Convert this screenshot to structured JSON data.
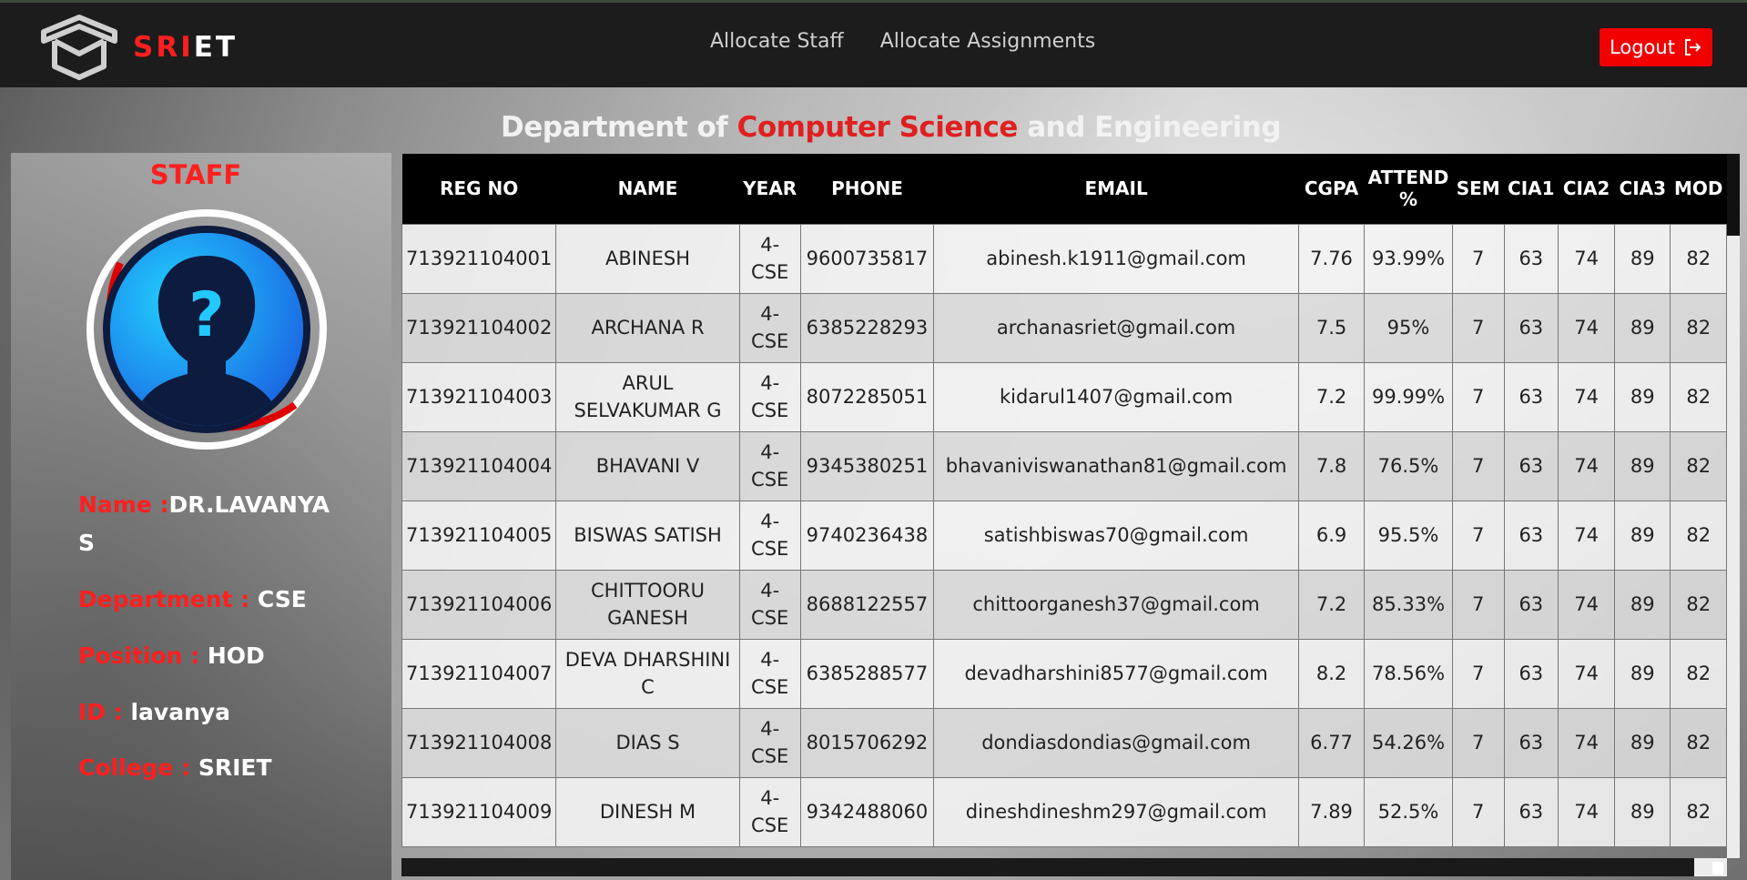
{
  "brand": {
    "part1": "SRI",
    "part2": "ET"
  },
  "nav": [
    {
      "label": "Allocate Staff"
    },
    {
      "label": "Allocate Assignments"
    }
  ],
  "logout_label": "Logout",
  "heading": {
    "prefix": "Department of ",
    "highlight": "Computer Science",
    "suffix": " and Engineering"
  },
  "staff": {
    "title": "STAFF",
    "name_label": "Name :",
    "name_value": "DR.LAVANYA S",
    "dept_label": "Department : ",
    "dept_value": "CSE",
    "position_label": "Position : ",
    "position_value": "HOD",
    "id_label": "ID : ",
    "id_value": "lavanya",
    "college_label": "College : ",
    "college_value": "SRIET"
  },
  "table": {
    "headers": [
      "REG NO",
      "NAME",
      "YEAR",
      "PHONE",
      "EMAIL",
      "CGPA",
      "ATTEND %",
      "SEM",
      "CIA1",
      "CIA2",
      "CIA3",
      "MOD"
    ],
    "rows": [
      [
        "713921104001",
        "ABINESH",
        "4-CSE",
        "9600735817",
        "abinesh.k1911@gmail.com",
        "7.76",
        "93.99%",
        "7",
        "63",
        "74",
        "89",
        "82"
      ],
      [
        "713921104002",
        "ARCHANA R",
        "4-CSE",
        "6385228293",
        "archanasriet@gmail.com",
        "7.5",
        "95%",
        "7",
        "63",
        "74",
        "89",
        "82"
      ],
      [
        "713921104003",
        "ARUL SELVAKUMAR G",
        "4-CSE",
        "8072285051",
        "kidarul1407@gmail.com",
        "7.2",
        "99.99%",
        "7",
        "63",
        "74",
        "89",
        "82"
      ],
      [
        "713921104004",
        "BHAVANI V",
        "4-CSE",
        "9345380251",
        "bhavaniviswanathan81@gmail.com",
        "7.8",
        "76.5%",
        "7",
        "63",
        "74",
        "89",
        "82"
      ],
      [
        "713921104005",
        "BISWAS SATISH",
        "4-CSE",
        "9740236438",
        "satishbiswas70@gmail.com",
        "6.9",
        "95.5%",
        "7",
        "63",
        "74",
        "89",
        "82"
      ],
      [
        "713921104006",
        "CHITTOORU GANESH",
        "4-CSE",
        "8688122557",
        "chittoorganesh37@gmail.com",
        "7.2",
        "85.33%",
        "7",
        "63",
        "74",
        "89",
        "82"
      ],
      [
        "713921104007",
        "DEVA DHARSHINI C",
        "4-CSE",
        "6385288577",
        "devadharshini8577@gmail.com",
        "8.2",
        "78.56%",
        "7",
        "63",
        "74",
        "89",
        "82"
      ],
      [
        "713921104008",
        "DIAS S",
        "4-CSE",
        "8015706292",
        "dondiasdondias@gmail.com",
        "6.77",
        "54.26%",
        "7",
        "63",
        "74",
        "89",
        "82"
      ],
      [
        "713921104009",
        "DINESH M",
        "4-CSE",
        "9342488060",
        "dineshdineshm297@gmail.com",
        "7.89",
        "52.5%",
        "7",
        "63",
        "74",
        "89",
        "82"
      ]
    ]
  },
  "colors": {
    "accent": "#ff1f1f",
    "header_bg": "#1c1c1c",
    "table_header_bg": "#000000"
  }
}
